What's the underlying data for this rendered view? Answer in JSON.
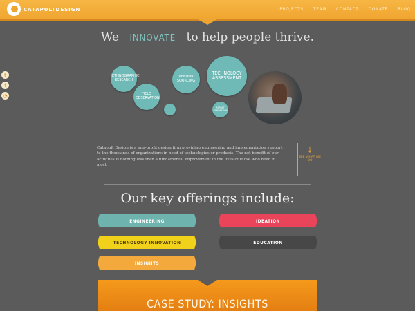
{
  "header": {
    "logo_text": "CATAPULTDESIGN",
    "nav": [
      "PROJECTS",
      "TEAM",
      "CONTACT",
      "DONATE",
      "BLOG"
    ]
  },
  "social": [
    "twitter-icon",
    "facebook-icon",
    "rss-icon"
  ],
  "tagline": {
    "before": "We",
    "highlight": "INNOVATE",
    "after": "to help people thrive."
  },
  "bubbles": {
    "ethnographic": "ETHNOGRAPHIC RESEARCH",
    "field": "FIELD OBSERVATION",
    "vendor": "VENDOR SOURCING",
    "technology": "TECHNOLOGY ASSESSMENT",
    "report": "REPORT GENERATION"
  },
  "about": {
    "paragraph": "Catapult Design is a non-profit design firm providing engineering and implementation support to the thousands of organizations in need of technologies or products. The net benefit of our activities is nothing less than a fundamental improvement in the lives of those who need it most.",
    "see_what": "SEE WHAT WE DO"
  },
  "offerings": {
    "title": "Our key offerings include:",
    "engineering": "ENGINEERING",
    "ideation": "IDEATION",
    "technology_innovation": "TECHNOLOGY INNOVATION",
    "education": "EDUCATION",
    "insights": "INSIGHTS"
  },
  "case_study": {
    "title": "CASE STUDY: INSIGHTS"
  },
  "colors": {
    "brand_orange": "#f0a530",
    "teal": "#6fbab6",
    "red": "#e9445a",
    "yellow": "#f2d11a",
    "dark": "#444444"
  }
}
